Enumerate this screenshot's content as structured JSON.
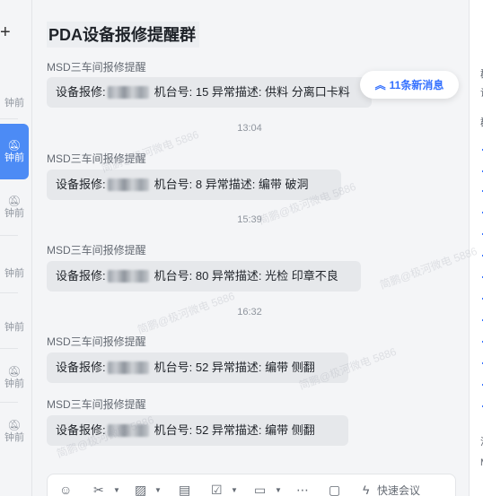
{
  "header": {
    "title": "PDA设备报修提醒群"
  },
  "left_strip": {
    "add_label": "+",
    "items": [
      {
        "ago": "钟前",
        "muted": false,
        "active": false
      },
      {
        "ago": "钟前",
        "muted": true,
        "active": true
      },
      {
        "ago": "钟前",
        "muted": true,
        "active": false
      },
      {
        "ago": "钟前",
        "muted": false,
        "active": false
      },
      {
        "ago": "钟前",
        "muted": false,
        "active": false
      },
      {
        "ago": "钟前",
        "muted": true,
        "active": false
      },
      {
        "ago": "钟前",
        "muted": true,
        "active": false
      }
    ]
  },
  "messages": [
    {
      "sender": "MSD三车间报修提醒",
      "text_a": "设备报修:",
      "text_b": "机台号:  15 异常描述: 供料 分离口卡料"
    },
    {
      "sender": "MSD三车间报修提醒",
      "text_a": "设备报修:",
      "text_b": "机台号:  8 异常描述: 编带 破洞"
    },
    {
      "sender": "MSD三车间报修提醒",
      "text_a": "设备报修:",
      "text_b": "机台号:  80 异常描述: 光检 印章不良"
    },
    {
      "sender": "MSD三车间报修提醒",
      "text_a": "设备报修:",
      "text_b": "机台号:  52 异常描述: 编带 侧翻"
    },
    {
      "sender": "MSD三车间报修提醒",
      "text_a": "设备报修:",
      "text_b": "机台号:  52 异常描述: 编带 侧翻"
    }
  ],
  "time_separators": [
    "13:04",
    "15:39",
    "16:32"
  ],
  "new_messages": {
    "arrow": "︽",
    "label": "11条新消息"
  },
  "right_panel": {
    "top_char_1": "群",
    "top_char_2": "设",
    "mid_char": "群",
    "bottom_char_1": "消",
    "bottom_char_2": "M"
  },
  "composer": {
    "quick_meeting_label": "快速会议",
    "icons": [
      "emoji-icon",
      "scissors-icon",
      "image-icon",
      "document-icon",
      "task-icon",
      "folder-icon",
      "more-icon",
      "calendar-icon",
      "lightning-icon"
    ]
  },
  "watermark": {
    "text": "简鹏@极河微电 5886"
  },
  "colors": {
    "accent": "#3370ff",
    "active_item": "#4c8bf5",
    "bubble": "#e6e8eb"
  }
}
